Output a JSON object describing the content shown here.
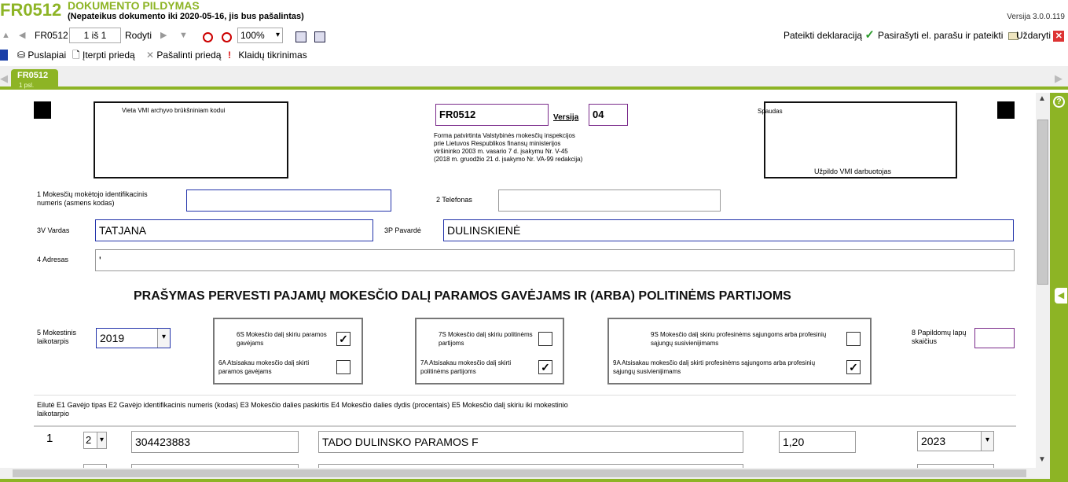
{
  "header": {
    "form_code": "FR0512",
    "title": "DOKUMENTO PILDYMAS",
    "subtitle": "(Nepateikus dokumento iki 2020-05-16, jis bus pašalintas)",
    "version": "Versija 3.0.0.119"
  },
  "toolbar": {
    "form_code": "FR0512",
    "page_value": "1 iš 1",
    "show_label": "Rodyti",
    "zoom": "100%",
    "submit_label": "Pateikti deklaraciją",
    "sign_label": "Pasirašyti el. parašu ir pateikti",
    "close_label": "Uždaryti"
  },
  "toolbar2": {
    "pages": "Puslapiai",
    "insert": "Įterpti priedą",
    "remove": "Pašalinti priedą",
    "errors": "Klaidų tikrinimas"
  },
  "tab": {
    "label": "FR0512",
    "sub": "1 psl."
  },
  "form": {
    "barcode_label": "Vieta VMI archyvo brūkšniniam kodui",
    "form_code": "FR0512",
    "version_label": "Versija",
    "version_value": "04",
    "approval": "Forma patvirtinta Valstybinės mokesčių inspekcijos\nprie Lietuvos Respublikos finansų ministerijos\nviršininko 2003 m. vasario 7 d. įsakymu Nr. V-45\n(2018 m. gruodžio 21 d. įsakymo Nr. VA-99 redakcija)",
    "stamp_label": "Spaudas",
    "stamp_footer": "Užpildo VMI darbuotojas",
    "f1_label": "1 Mokesčių mokėtojo identifikacinis numeris (asmens kodas)",
    "f1_value": "",
    "f2_label": "2 Telefonas",
    "f2_value": "",
    "f3v_label": "3V Vardas",
    "f3v_value": "TATJANA",
    "f3p_label": "3P Pavardė",
    "f3p_value": "DULINSKIENĖ",
    "f4_label": "4 Adresas",
    "f4_value": "'",
    "section_title": "PRAŠYMAS PERVESTI PAJAMŲ MOKESČIO DALĮ PARAMOS GAVĖJAMS IR (ARBA) POLITINĖMS PARTIJOMS",
    "f5_label": "5 Mokestinis laikotarpis",
    "f5_value": "2019",
    "f6s_label": "6S Mokesčio dalį skiriu paramos gavėjams",
    "f6a_label": "6A Atsisakau mokesčio dalį skirti paramos gavėjams",
    "f7s_label": "7S Mokesčio dalį skiriu politinėms partijoms",
    "f7a_label": "7A Atsisakau mokesčio dalį skirti politinėms partijoms",
    "f9s_label": "9S Mokesčio dalį skiriu profesinėms sąjungoms arba profesinių sąjungų susivienijimams",
    "f9a_label": "9A Atsisakau mokesčio dalį skirti profesinėms sąjungoms arba profesinių sąjungų susivienijimams",
    "f8_label": "8 Papildomų lapų skaičius",
    "f8_value": "",
    "check_mark": "✓",
    "table_header": "Eilutė E1 Gavėjo tipas E2 Gavėjo identifikacinis numeris (kodas) E3 Mokesčio dalies paskirtis E4 Mokesčio dalies dydis (procentais) E5 Mokesčio dalį skiriu iki mokestinio laikotarpio",
    "rows": [
      {
        "num": "1",
        "type": "2",
        "code": "304423883",
        "purpose": "TADO DULINSKO PARAMOS F",
        "percent": "1,20",
        "until": "2023"
      }
    ]
  }
}
